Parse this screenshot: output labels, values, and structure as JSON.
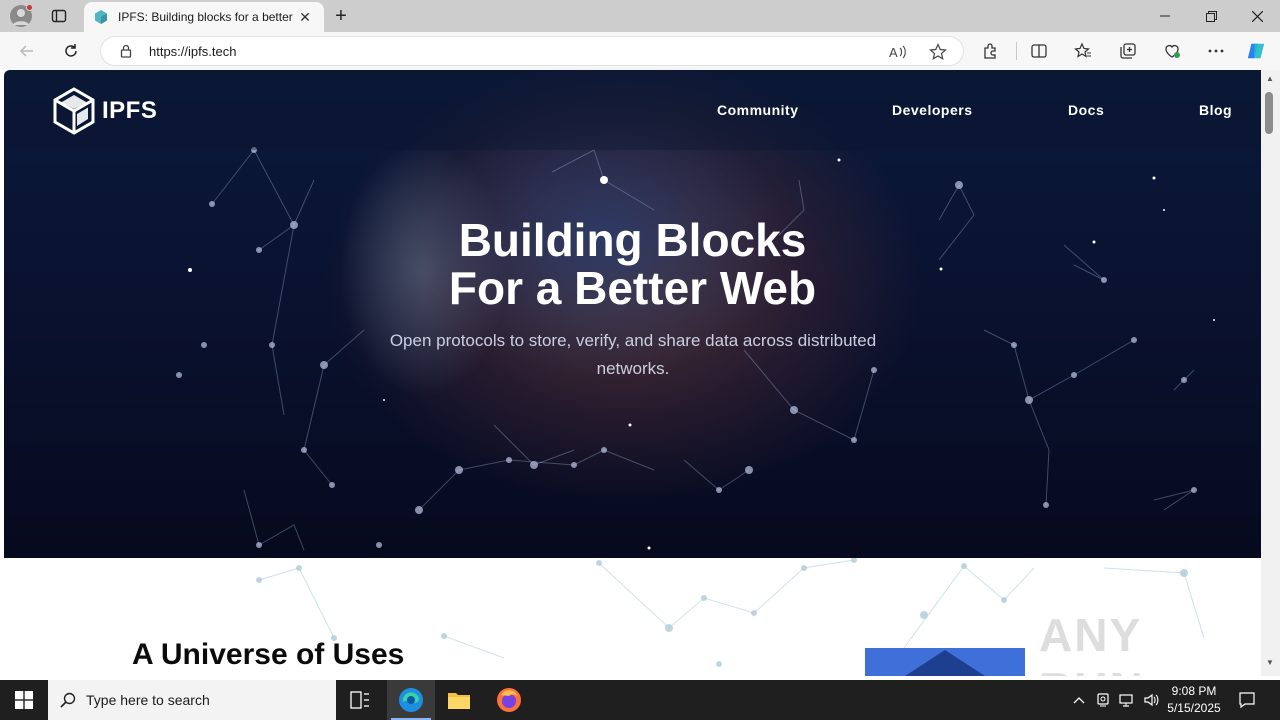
{
  "browser": {
    "tab": {
      "title": "IPFS: Building blocks for a better"
    },
    "address": {
      "url": "https://ipfs.tech"
    }
  },
  "page": {
    "logo_text": "IPFS",
    "nav": [
      {
        "label": "Community"
      },
      {
        "label": "Developers"
      },
      {
        "label": "Docs"
      },
      {
        "label": "Blog"
      }
    ],
    "hero": {
      "title_line1": "Building Blocks",
      "title_line2": "For a Better Web",
      "subtitle": "Open protocols to store, verify, and share data across distributed networks."
    },
    "section_title": "A Universe of Uses",
    "watermark": "ANY RUN"
  },
  "taskbar": {
    "search_placeholder": "Type here to search",
    "time": "9:08 PM",
    "date": "5/15/2025"
  },
  "colors": {
    "hero_bg": "#0a1230",
    "accent_blue": "#3f6fd8",
    "taskbar": "#1f1f1f"
  }
}
